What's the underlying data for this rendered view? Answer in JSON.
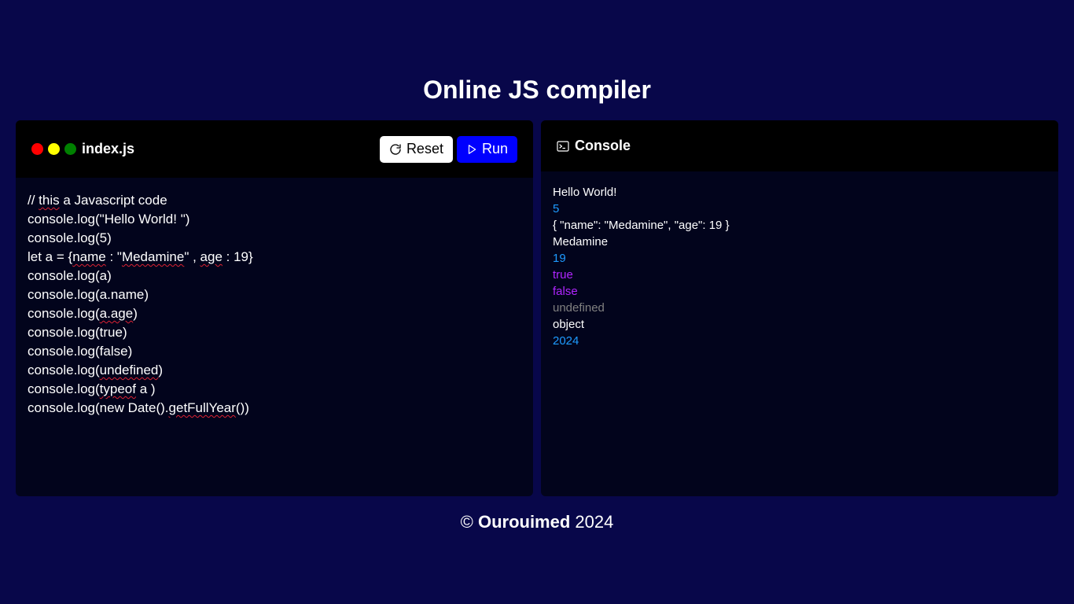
{
  "page": {
    "title": "Online JS compiler"
  },
  "editor": {
    "file_name": "index.js",
    "reset_label": "Reset",
    "run_label": "Run",
    "code_lines": [
      [
        {
          "t": "// "
        },
        {
          "t": "this",
          "sq": true
        },
        {
          "t": " a Javascript code"
        }
      ],
      [
        {
          "t": "console.log(\"Hello World! \")"
        }
      ],
      [
        {
          "t": "console.log(5)"
        }
      ],
      [
        {
          "t": "let a = {"
        },
        {
          "t": "name",
          "sq": true
        },
        {
          "t": " : \""
        },
        {
          "t": "Medamine",
          "sq": true
        },
        {
          "t": "\" , "
        },
        {
          "t": "age",
          "sq": true
        },
        {
          "t": " : 19}"
        }
      ],
      [
        {
          "t": "console.log(a)"
        }
      ],
      [
        {
          "t": "console.log(a.name)"
        }
      ],
      [
        {
          "t": "console.log("
        },
        {
          "t": "a.age",
          "sq": true
        },
        {
          "t": ")"
        }
      ],
      [
        {
          "t": "console.log(true)"
        }
      ],
      [
        {
          "t": "console.log(false)"
        }
      ],
      [
        {
          "t": "console.log("
        },
        {
          "t": "undefined",
          "sq": true
        },
        {
          "t": ")"
        }
      ],
      [
        {
          "t": "console.log("
        },
        {
          "t": "typeof",
          "sq": true
        },
        {
          "t": " a )"
        }
      ],
      [
        {
          "t": "console.log(new Date()."
        },
        {
          "t": "getFullYear",
          "sq": true
        },
        {
          "t": "())"
        }
      ]
    ]
  },
  "console": {
    "title": "Console",
    "output": [
      {
        "text": "Hello World!",
        "color": "#ffffff"
      },
      {
        "text": "5",
        "color": "#1e9bff"
      },
      {
        "text": "{ \"name\": \"Medamine\", \"age\": 19 }",
        "color": "#ffffff"
      },
      {
        "text": "Medamine",
        "color": "#ffffff"
      },
      {
        "text": "19",
        "color": "#1e9bff"
      },
      {
        "text": "true",
        "color": "#b026ff"
      },
      {
        "text": "false",
        "color": "#b026ff"
      },
      {
        "text": "undefined",
        "color": "#808080"
      },
      {
        "text": "object",
        "color": "#ffffff"
      },
      {
        "text": "2024",
        "color": "#1e9bff"
      }
    ]
  },
  "footer": {
    "copyright_symbol": "©",
    "author": "Ourouimed",
    "year": "2024"
  },
  "colors": {
    "background": "#08074a",
    "panel_body": "#02041c",
    "panel_header": "#000000",
    "run_button": "#0000ff",
    "number_output": "#1e9bff",
    "boolean_output": "#b026ff",
    "undefined_output": "#808080"
  },
  "icons": {
    "reset": "rotate-cw-icon",
    "run": "play-icon",
    "console": "terminal-icon"
  }
}
